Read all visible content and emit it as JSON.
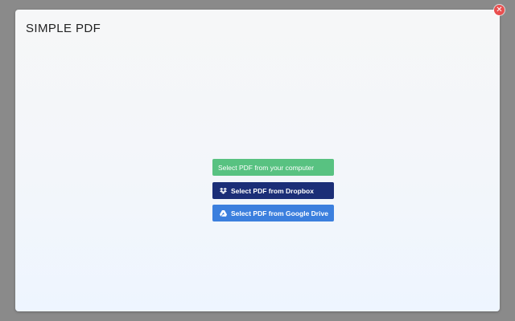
{
  "app": {
    "title": "SIMPLE PDF"
  },
  "close": {
    "glyph": "✕",
    "icon": "close-icon",
    "color": "#e94f4f"
  },
  "buttons": {
    "local": {
      "label": "Select PDF from your computer",
      "color": "#58c281"
    },
    "dropbox": {
      "label": "Select PDF from Dropbox",
      "icon": "dropbox-icon",
      "color": "#1b2e77"
    },
    "gdrive": {
      "label": "Select PDF from Google Drive",
      "icon": "google-drive-icon",
      "color": "#3b7fde"
    }
  }
}
